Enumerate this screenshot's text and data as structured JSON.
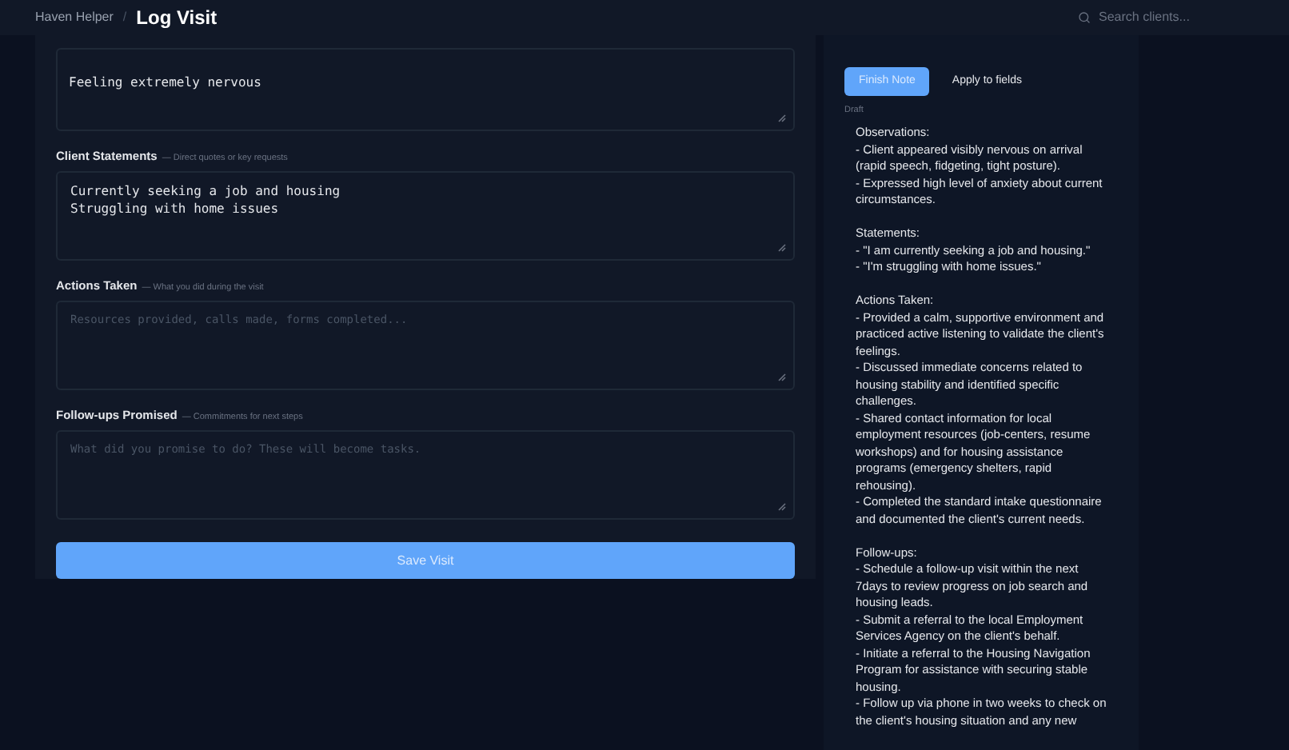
{
  "header": {
    "app": "Haven Helper",
    "separator": "/",
    "title": "Log Visit",
    "search": {
      "placeholder": "Search clients..."
    }
  },
  "form": {
    "observation": {
      "value": "Feeling extremely nervous"
    },
    "fields": [
      {
        "label": "Client Statements",
        "hint": "— Direct quotes or key requests",
        "value": "Currently seeking a job and housing\nStruggling with home issues"
      },
      {
        "label": "Actions Taken",
        "hint": "— What you did during the visit",
        "placeholder": "Resources provided, calls made, forms completed..."
      },
      {
        "label": "Follow-ups Promised",
        "hint": "— Commitments for next steps",
        "placeholder": "What did you promise to do? These will become tasks."
      }
    ],
    "save_button": "Save Visit"
  },
  "note_panel": {
    "actions": [
      {
        "label": "Finish Note",
        "selected": true
      },
      {
        "label": "Apply to fields",
        "selected": false
      }
    ],
    "status": "Draft",
    "sections": [
      {
        "heading": "Observations:",
        "lines": [
          "- Client appeared visibly nervous on arrival (rapid speech, fidgeting, tight posture).",
          "- Expressed high level of anxiety about current circumstances."
        ]
      },
      {
        "heading": "Statements:",
        "lines": [
          "- \"I am currently seeking a job and housing.\"",
          "- \"I'm struggling with home issues.\""
        ]
      },
      {
        "heading": "Actions Taken:",
        "lines": [
          "- Provided a calm, supportive environment and practiced active listening to validate the client's feelings.",
          "- Discussed immediate concerns related to housing stability and identified specific challenges.",
          "- Shared contact information for local employment resources (job-centers, resume workshops) and for housing assistance programs (emergency shelters, rapid rehousing).",
          "- Completed the standard intake questionnaire and documented the client's current needs."
        ]
      },
      {
        "heading": "Follow-ups:",
        "lines": [
          "- Schedule a follow-up visit within the next 7days to review progress on job search and housing leads.",
          "- Submit a referral to the local Employment Services Agency on the client's behalf.",
          "- Initiate a referral to the Housing Navigation Program for assistance with securing stable housing.",
          "- Follow up via phone in two weeks to check on the client's housing situation and any new"
        ]
      }
    ]
  }
}
